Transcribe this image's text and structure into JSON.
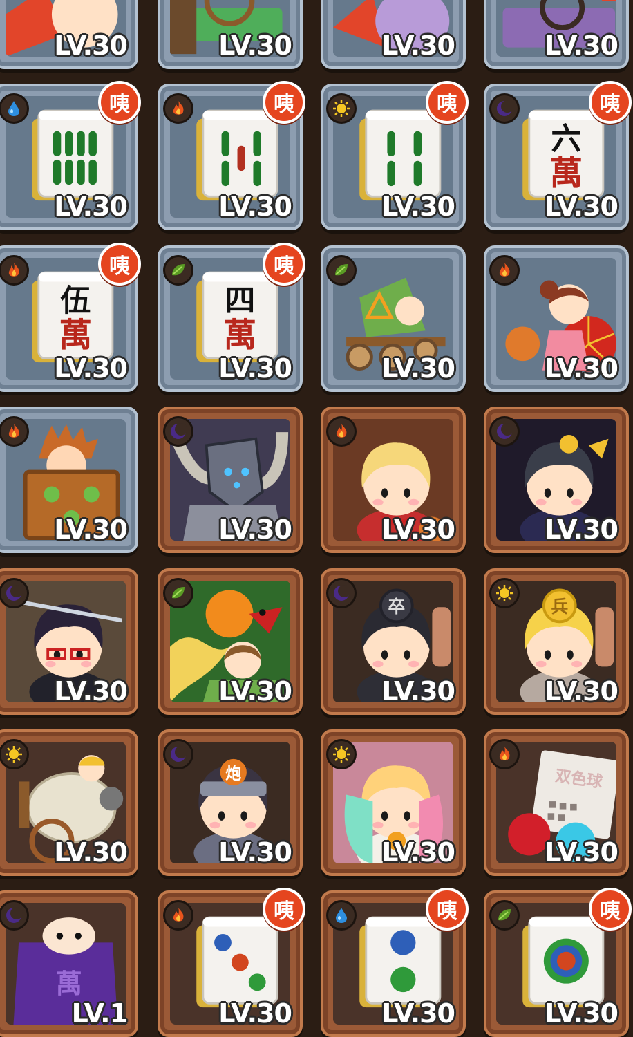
{
  "colors": {
    "fire": "#e8541c",
    "water": "#2e8fe0",
    "light": "#f5c623",
    "dark": "#4a2a86",
    "wood": "#5a9b24",
    "badge": "#e5451f"
  },
  "rows": [
    [
      {
        "level": "LV.30",
        "element": "none",
        "badge": "",
        "art": "hero-red-partial",
        "frame": "gray"
      },
      {
        "level": "LV.30",
        "element": "none",
        "badge": "",
        "art": "cart-partial",
        "frame": "gray"
      },
      {
        "level": "LV.30",
        "element": "none",
        "badge": "",
        "art": "hero-purple-partial",
        "frame": "gray"
      },
      {
        "level": "LV.30",
        "element": "none",
        "badge": "",
        "art": "chariot-partial",
        "frame": "gray"
      }
    ],
    [
      {
        "level": "LV.30",
        "element": "water",
        "badge": "咦",
        "art": "mahjong-tile-8-bamboo",
        "frame": "gray"
      },
      {
        "level": "LV.30",
        "element": "fire",
        "badge": "咦",
        "art": "mahjong-tile-5-bamboo",
        "frame": "gray"
      },
      {
        "level": "LV.30",
        "element": "light",
        "badge": "咦",
        "art": "mahjong-tile-4-bamboo",
        "frame": "gray"
      },
      {
        "level": "LV.30",
        "element": "dark",
        "badge": "咦",
        "art": "mahjong-tile-6-character",
        "frame": "gray"
      }
    ],
    [
      {
        "level": "LV.30",
        "element": "fire",
        "badge": "咦",
        "art": "mahjong-tile-5-character",
        "frame": "gray"
      },
      {
        "level": "LV.30",
        "element": "wood",
        "badge": "咦",
        "art": "mahjong-tile-4-character",
        "frame": "gray"
      },
      {
        "level": "LV.30",
        "element": "wood",
        "badge": "",
        "art": "green-cart-hero",
        "frame": "gray"
      },
      {
        "level": "LV.30",
        "element": "fire",
        "badge": "",
        "art": "fan-girl-hero",
        "frame": "gray"
      }
    ],
    [
      {
        "level": "LV.30",
        "element": "fire",
        "badge": "",
        "art": "hedgehog-in-crate",
        "frame": "gray"
      },
      {
        "level": "LV.30",
        "element": "dark",
        "badge": "",
        "art": "armored-knight",
        "frame": "brown"
      },
      {
        "level": "LV.30",
        "element": "fire",
        "badge": "",
        "art": "blonde-girl",
        "frame": "brown"
      },
      {
        "level": "LV.30",
        "element": "dark",
        "badge": "",
        "art": "dark-haired-princess",
        "frame": "brown"
      }
    ],
    [
      {
        "level": "LV.30",
        "element": "dark",
        "badge": "",
        "art": "glasses-swordsman",
        "frame": "brown"
      },
      {
        "level": "LV.30",
        "element": "wood",
        "badge": "",
        "art": "phoenix-rider",
        "frame": "brown"
      },
      {
        "level": "LV.30",
        "element": "dark",
        "badge": "",
        "art": "dark-soldier",
        "frame": "brown"
      },
      {
        "level": "LV.30",
        "element": "light",
        "badge": "",
        "art": "blonde-soldier",
        "frame": "brown"
      }
    ],
    [
      {
        "level": "LV.30",
        "element": "light",
        "badge": "",
        "art": "cannon-cart",
        "frame": "brown"
      },
      {
        "level": "LV.30",
        "element": "dark",
        "badge": "",
        "art": "cannon-ninja",
        "frame": "brown"
      },
      {
        "level": "LV.30",
        "element": "light",
        "badge": "",
        "art": "colorful-girl",
        "frame": "brown"
      },
      {
        "level": "LV.30",
        "element": "fire",
        "badge": "",
        "art": "lottery-balls",
        "frame": "brown"
      }
    ],
    [
      {
        "level": "LV.1",
        "element": "dark",
        "badge": "",
        "art": "purple-ghost",
        "frame": "brown"
      },
      {
        "level": "LV.30",
        "element": "fire",
        "badge": "咦",
        "art": "mahjong-tile-3-dots",
        "frame": "brown"
      },
      {
        "level": "LV.30",
        "element": "water",
        "badge": "咦",
        "art": "mahjong-tile-2-dots",
        "frame": "brown"
      },
      {
        "level": "LV.30",
        "element": "wood",
        "badge": "咦",
        "art": "mahjong-tile-1-dot",
        "frame": "brown"
      }
    ]
  ],
  "mahjong_characters": {
    "six": "六",
    "five": "伍",
    "four": "四",
    "wan": "萬"
  },
  "art_text": {
    "soldier_dark": "卒",
    "soldier_light": "兵",
    "cannon": "炮",
    "lottery": "双色球",
    "ghost": "萬"
  }
}
